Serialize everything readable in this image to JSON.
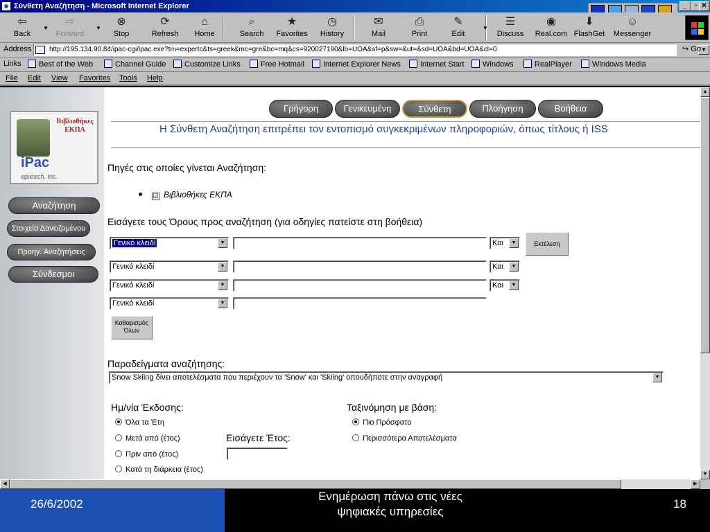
{
  "window": {
    "title": "Σύνθετη Αναζήτηση - Microsoft Internet Explorer",
    "min_label": "_",
    "max_label": "▫",
    "close_label": "✕"
  },
  "toolbar": {
    "buttons": [
      {
        "label": "Back",
        "icon": "back-arrow-icon",
        "glyph": "⇦",
        "enabled": true
      },
      {
        "label": "Forward",
        "icon": "forward-arrow-icon",
        "glyph": "⇨",
        "enabled": false
      },
      {
        "label": "Stop",
        "icon": "stop-icon",
        "glyph": "⊗",
        "enabled": true
      },
      {
        "label": "Refresh",
        "icon": "refresh-icon",
        "glyph": "⟳",
        "enabled": true
      },
      {
        "label": "Home",
        "icon": "home-icon",
        "glyph": "⌂",
        "enabled": true
      },
      {
        "label": "Search",
        "icon": "search-icon",
        "glyph": "⌕",
        "enabled": true
      },
      {
        "label": "Favorites",
        "icon": "favorites-icon",
        "glyph": "★",
        "enabled": true
      },
      {
        "label": "History",
        "icon": "history-icon",
        "glyph": "◷",
        "enabled": true
      },
      {
        "label": "Mail",
        "icon": "mail-icon",
        "glyph": "✉",
        "enabled": true
      },
      {
        "label": "Print",
        "icon": "print-icon",
        "glyph": "⎙",
        "enabled": true
      },
      {
        "label": "Edit",
        "icon": "edit-icon",
        "glyph": "✎",
        "enabled": true
      },
      {
        "label": "Discuss",
        "icon": "discuss-icon",
        "glyph": "☰",
        "enabled": true
      },
      {
        "label": "Real.com",
        "icon": "realcom-icon",
        "glyph": "◉",
        "enabled": true
      },
      {
        "label": "FlashGet",
        "icon": "flashget-icon",
        "glyph": "⬇",
        "enabled": true
      },
      {
        "label": "Messenger",
        "icon": "messenger-icon",
        "glyph": "☺",
        "enabled": true
      }
    ]
  },
  "address": {
    "label": "Address",
    "url": "http://195.134.90.84/ipac-cgi/ipac.exe?tm=expertc&ts=greek&mc=gre&bc=mq&cs=920027190&lb=UOA&sf=p&sw=&ut=&sd=UOA&bd=UOA&cl=0",
    "go_label": "Go"
  },
  "links": {
    "label": "Links",
    "items": [
      "Best of the Web",
      "Channel Guide",
      "Customize Links",
      "Free Hotmail",
      "Internet Explorer News",
      "Internet Start",
      "Windows",
      "RealPlayer",
      "Windows Media"
    ]
  },
  "menu": {
    "items": [
      "File",
      "Edit",
      "View",
      "Favorites",
      "Tools",
      "Help"
    ]
  },
  "logo": {
    "name": "Βιβλιοθήκες ΕΚΠΑ",
    "product": "iPac",
    "vendor": "epixtech, Inc."
  },
  "sidebar": {
    "items": [
      "Αναζήτηση",
      "Στοιχεία Δανειζομένου",
      "Προηγ. Αναζητήσεις",
      "Σύνδεσμοι"
    ]
  },
  "nav_tabs": [
    {
      "label": "Γρήγορη",
      "active": false
    },
    {
      "label": "Γενικευμένη",
      "active": false
    },
    {
      "label": "Σύνθετη",
      "active": true
    },
    {
      "label": "Πλοήγηση",
      "active": false
    },
    {
      "label": "Βοήθεια",
      "active": false
    }
  ],
  "intro_text": "Η Σύνθετη Αναζήτηση επιτρέπει τον εντοπισμό συγκεκριμένων πληροφοριών, όπως τίτλους ή ISS",
  "sources": {
    "heading": "Πηγές στις οποίες γίνεται Αναζήτηση:",
    "checkbox_mark": "☑",
    "items": [
      {
        "label": "Βιβλιοθήκες ΕΚΠΑ",
        "checked": true
      }
    ]
  },
  "terms": {
    "heading": "Εισάγετε τους Όρους προς αναζήτηση (για οδηγίες πατείστε στη βοήθεια)",
    "rows": [
      {
        "field": "Γενικό κλειδί",
        "value": "",
        "operator": "Και"
      },
      {
        "field": "Γενικό κλειδί",
        "value": "",
        "operator": "Και"
      },
      {
        "field": "Γενικό κλειδί",
        "value": "",
        "operator": "Και"
      },
      {
        "field": "Γενικό κλειδί",
        "value": "",
        "operator": ""
      }
    ],
    "execute_label": "Εκτέλεση",
    "clear_label_line1": "Καθαρισμός",
    "clear_label_line2": "Όλων"
  },
  "examples": {
    "heading": "Παραδείγματα αναζήτησης:",
    "selected": "Snow Skiing δίνει αποτελέσματα που περιέχουν τα 'Snow' και 'Skiing' οπουδήποτε στην αναγραφή"
  },
  "date_filter": {
    "heading": "Ημ/νία Έκδοσης:",
    "options": [
      {
        "label": "Όλα τα Έτη",
        "selected": true
      },
      {
        "label": "Μετά από (έτος)",
        "selected": false
      },
      {
        "label": "Πριν από (έτος)",
        "selected": false
      },
      {
        "label": "Κατά τη διάρκεια (έτος)",
        "selected": false
      }
    ],
    "year_label": "Εισάγετε Έτος:",
    "year_value": ""
  },
  "sort": {
    "heading": "Ταξινόμηση με βάση:",
    "options": [
      {
        "label": "Πιο Πρόσφατο",
        "selected": true
      },
      {
        "label": "Περισσότερα Αποτελέσματα",
        "selected": false
      }
    ]
  },
  "footer": {
    "date": "26/6/2002",
    "title_line1": "Ενημέρωση πάνω στις νέες",
    "title_line2": "ψηφιακές υπηρεσίες",
    "page": "18"
  },
  "colors": {
    "title_bar": "#000080",
    "intro_text": "#1e3ca0",
    "footer_blue": "#1e50b4",
    "active_tab_border": "#c8a040"
  }
}
